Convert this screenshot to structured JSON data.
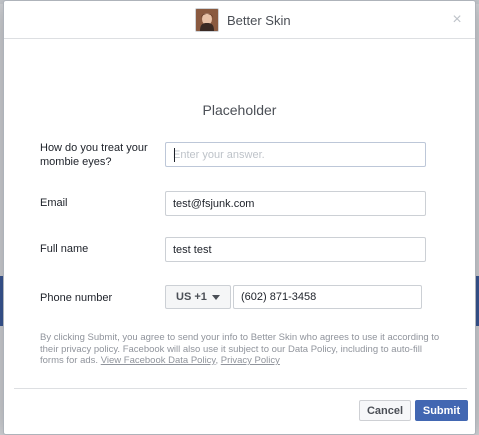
{
  "header": {
    "title": "Better Skin",
    "close_icon": "close-icon",
    "avatar_icon": "avatar"
  },
  "form": {
    "title": "Placeholder",
    "fields": [
      {
        "label": "How do you treat your mombie eyes?",
        "value": "",
        "placeholder": "Enter your answer."
      },
      {
        "label": "Email",
        "value": "test@fsjunk.com",
        "placeholder": ""
      },
      {
        "label": "Full name",
        "value": "test test",
        "placeholder": ""
      }
    ],
    "phone": {
      "label": "Phone number",
      "country_code": "US +1",
      "value": "(602) 871-3458"
    }
  },
  "disclaimer": {
    "text": "By clicking Submit, you agree to send your info to Better Skin who agrees to use it according to their privacy policy. Facebook will also use it subject to our Data Policy, including to auto-fill forms for ads. ",
    "link1": "View Facebook Data Policy",
    "separator": ", ",
    "link2": "Privacy Policy"
  },
  "footer": {
    "cancel_label": "Cancel",
    "submit_label": "Submit"
  },
  "colors": {
    "primary": "#4267b2",
    "backdrop_band": "#3b5998",
    "muted_text": "#90949c"
  }
}
